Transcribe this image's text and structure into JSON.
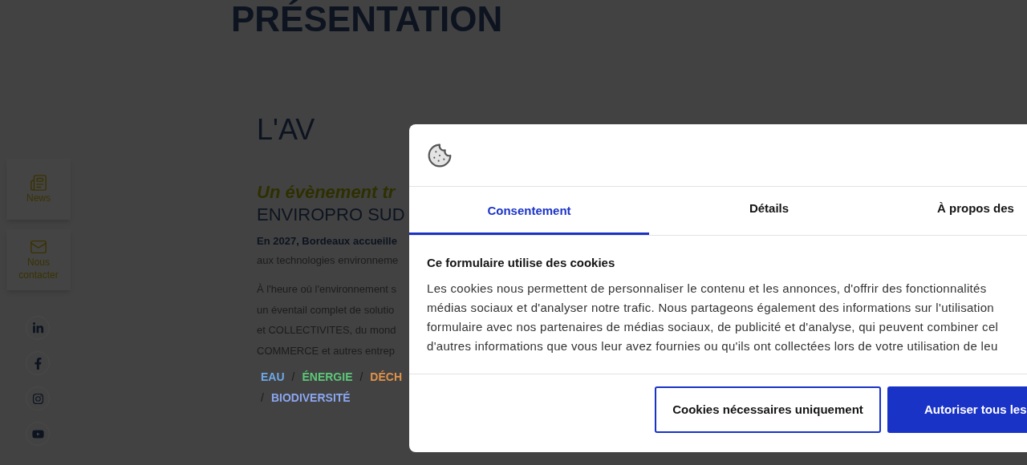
{
  "page": {
    "title": "PRÉSENTATION",
    "section_title": "L'AV",
    "tagline": "Un évènement tr",
    "event_name": "ENVIROPRO SUD",
    "lead": "En 2027, Bordeaux accueille",
    "lead_rest": "aux technologies environneme",
    "body_lines": [
      "À l'heure où l'environnement s",
      "un éventail complet de solutio",
      "et COLLECTIVITES, du mond",
      "COMMERCE et autres entrep"
    ],
    "tag_rows": [
      [
        {
          "kind": "tag",
          "label": "EAU",
          "color": "#6fa8e8"
        },
        {
          "kind": "separator",
          "label": "/"
        },
        {
          "kind": "tag",
          "label": "ÉNERGIE",
          "color": "#5cc878"
        },
        {
          "kind": "separator",
          "label": "/"
        },
        {
          "kind": "tag",
          "label": "DÉCH",
          "color": "#e0934a"
        }
      ],
      [
        {
          "kind": "separator",
          "label": "/"
        },
        {
          "kind": "tag",
          "label": "BIODIVERSITÉ",
          "color": "#8ca6f0"
        }
      ]
    ]
  },
  "sidebar": {
    "items": [
      {
        "kind": "news",
        "label": "News"
      },
      {
        "kind": "mail",
        "label": "Nous contacter"
      }
    ],
    "socials": [
      {
        "kind": "linkedin"
      },
      {
        "kind": "facebook"
      },
      {
        "kind": "instagram"
      },
      {
        "kind": "youtube"
      }
    ]
  },
  "cookie_dialog": {
    "tabs": [
      {
        "label": "Consentement",
        "selected": true
      },
      {
        "label": "Détails",
        "selected": false
      },
      {
        "label": "À propos des",
        "selected": false
      }
    ],
    "title": "Ce formulaire utilise des cookies",
    "text_lines": [
      "Les cookies nous permettent de personnaliser le contenu et les annonces, d'offrir des fonctionnalités",
      "médias sociaux et d'analyser notre trafic. Nous partageons également des informations sur l'utilisation",
      "formulaire avec nos partenaires de médias sociaux, de publicité et d'analyse, qui peuvent combiner cel",
      "d'autres informations que vous leur avez fournies ou qu'ils ont collectées lors de votre utilisation de leu"
    ],
    "buttons": [
      {
        "kind": "outline",
        "label": "Cookies nécessaires uniquement"
      },
      {
        "kind": "primary",
        "label": "Autoriser tous les"
      }
    ]
  }
}
